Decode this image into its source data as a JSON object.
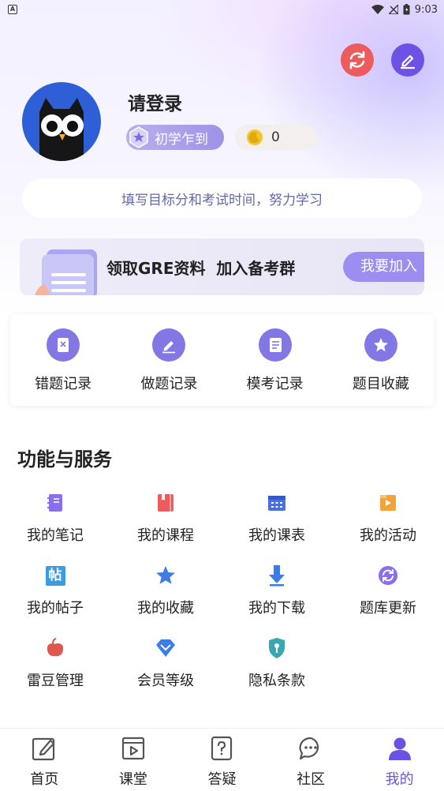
{
  "status_bar": {
    "time": "9:03",
    "notification_glyph": "A"
  },
  "profile": {
    "login_prompt": "请登录",
    "level": "初学乍到",
    "coins": "0",
    "goal_prompt": "填写目标分和考试时间，努力学习"
  },
  "banner": {
    "text": "领取GRE资料  加入备考群",
    "button": "我要加入"
  },
  "records": [
    {
      "label": "错题记录",
      "icon": "wrong-questions-icon"
    },
    {
      "label": "做题记录",
      "icon": "practice-icon"
    },
    {
      "label": "模考记录",
      "icon": "mock-exam-icon"
    },
    {
      "label": "题目收藏",
      "icon": "star-icon"
    }
  ],
  "services": {
    "title": "功能与服务",
    "items": [
      {
        "label": "我的笔记",
        "icon": "notebook-icon",
        "color": "#8b6df0"
      },
      {
        "label": "我的课程",
        "icon": "course-book-icon",
        "color": "#ec5c5c"
      },
      {
        "label": "我的课表",
        "icon": "calendar-icon",
        "color": "#4a6fe0"
      },
      {
        "label": "我的活动",
        "icon": "activity-icon",
        "color": "#f2a33a"
      },
      {
        "label": "我的帖子",
        "icon": "post-icon",
        "color": "#3d9be0"
      },
      {
        "label": "我的收藏",
        "icon": "star-icon",
        "color": "#3d7ce6"
      },
      {
        "label": "我的下载",
        "icon": "download-icon",
        "color": "#3d7ce6"
      },
      {
        "label": "题库更新",
        "icon": "refresh-icon",
        "color": "#8b6df0"
      },
      {
        "label": "雷豆管理",
        "icon": "bean-icon",
        "color": "#e0574f"
      },
      {
        "label": "会员等级",
        "icon": "diamond-icon",
        "color": "#3d7ce6"
      },
      {
        "label": "隐私条款",
        "icon": "privacy-shield-icon",
        "color": "#3aa6b0"
      }
    ],
    "post_glyph": "帖"
  },
  "bottom_nav": [
    {
      "label": "首页",
      "icon": "home-edit-icon"
    },
    {
      "label": "课堂",
      "icon": "classroom-icon"
    },
    {
      "label": "答疑",
      "icon": "question-icon"
    },
    {
      "label": "社区",
      "icon": "community-icon"
    },
    {
      "label": "我的",
      "icon": "profile-icon",
      "active": true
    }
  ],
  "colors": {
    "accent": "#6b52e2",
    "refresh_button": "#ec5c5c"
  }
}
